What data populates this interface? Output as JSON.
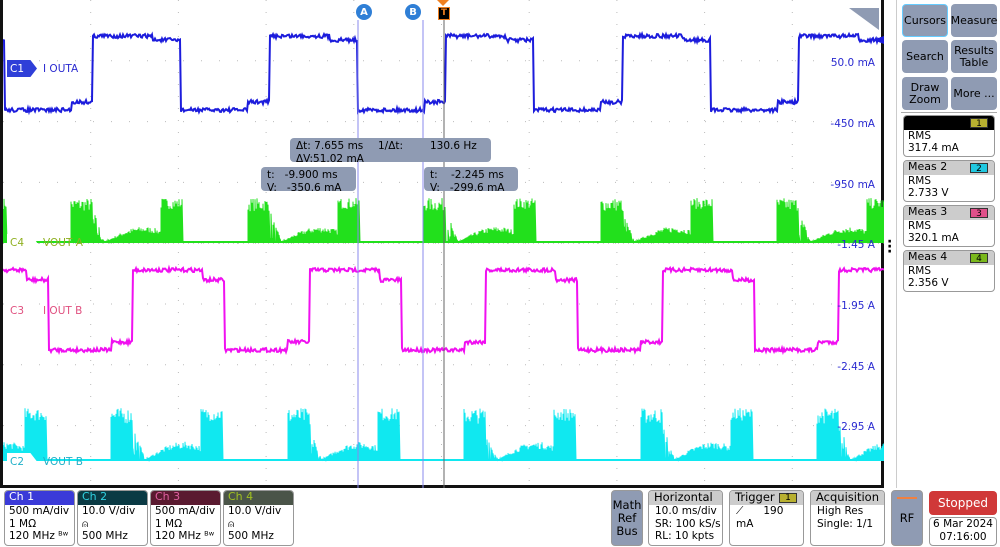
{
  "channels_on_plot": [
    {
      "tag": "C1",
      "label": "I OUTA",
      "color": "#1c1cdc",
      "tagcolor": "#2f3fd8"
    },
    {
      "tag": "C4",
      "label": "VOUT  A",
      "color": "#22e01c",
      "tagcolor": "#8fb020"
    },
    {
      "tag": "C3",
      "label": "I OUT B",
      "color": "#f010f0",
      "tagcolor": "#e0507f"
    },
    {
      "tag": "C2",
      "label": "VOUT B",
      "color": "#10e8f0",
      "tagcolor": "#20b0c8"
    }
  ],
  "scale_labels": [
    "50.0 mA",
    "-450 mA",
    "-950 mA",
    "-1.45 A",
    "-1.95 A",
    "-2.45 A",
    "-2.95 A"
  ],
  "cursors": {
    "a_label": "A",
    "b_label": "B",
    "trigger_label": "T",
    "delta": {
      "dt": "Δt: 7.655 ms",
      "inv": "1/Δt:",
      "inv_val": "130.6 Hz",
      "dv": "ΔV:51.02 mA"
    },
    "a": {
      "t": "t:   -9.900 ms",
      "v": "V:   -350.6 mA"
    },
    "b": {
      "t": "t:    -2.245 ms",
      "v": "V:   -299.6 mA"
    }
  },
  "side": {
    "buttons": [
      "Cursors",
      "Measure",
      "Search",
      "Results Table",
      "Draw Zoom",
      "More ..."
    ],
    "measurements": [
      {
        "title": "",
        "num": "1",
        "type": "RMS",
        "value": "317.4 mA",
        "color": "#b8b030"
      },
      {
        "title": "Meas 2",
        "num": "2",
        "type": "RMS",
        "value": "2.733 V",
        "color": "#20c8e0"
      },
      {
        "title": "Meas 3",
        "num": "3",
        "type": "RMS",
        "value": "320.1 mA",
        "color": "#e0508a"
      },
      {
        "title": "Meas 4",
        "num": "4",
        "type": "RMS",
        "value": "2.356 V",
        "color": "#7ab81c"
      }
    ]
  },
  "bottom": {
    "channels": [
      {
        "name": "Ch 1",
        "l1": "500 mA/div",
        "l2": "1 MΩ",
        "l3": "120 MHz ᴮʷ",
        "hdbg": "#3a3ad8",
        "hdfg": "#fff"
      },
      {
        "name": "Ch 2",
        "l1": "10.0 V/div",
        "l2": "⍝",
        "l3": "500 MHz",
        "hdbg": "#0a3a44",
        "hdfg": "#30d0e0"
      },
      {
        "name": "Ch 3",
        "l1": "500 mA/div",
        "l2": "1 MΩ",
        "l3": "120 MHz ᴮʷ",
        "hdbg": "#5a1a30",
        "hdfg": "#e060a0"
      },
      {
        "name": "Ch 4",
        "l1": "10.0 V/div",
        "l2": "⍝",
        "l3": "500 MHz",
        "hdbg": "#4a5448",
        "hdfg": "#a0c020"
      }
    ],
    "math": "Math Ref Bus",
    "horizontal": {
      "title": "Horizontal",
      "l1": "10.0 ms/div",
      "l2": "SR: 100 kS/s",
      "l3": "RL: 10 kpts"
    },
    "trigger": {
      "title": "Trigger",
      "src": "1",
      "level": "190 mA"
    },
    "acquisition": {
      "title": "Acquisition",
      "l1": "High Res",
      "l2": "Single: 1/1"
    },
    "rf": "RF",
    "status": "Stopped",
    "date": "6 Mar 2024",
    "time": "07:16:00"
  }
}
